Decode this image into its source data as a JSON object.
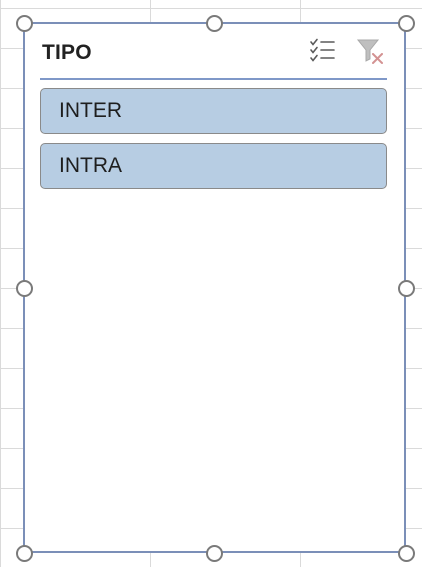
{
  "slicer": {
    "title": "TIPO",
    "items": [
      {
        "label": "INTER",
        "selected": true
      },
      {
        "label": "INTRA",
        "selected": true
      }
    ],
    "icons": {
      "multiselect": "multi-select-icon",
      "clear_filter": "clear-filter-icon"
    },
    "colors": {
      "item_fill": "#b7cde3",
      "border": "#7b8fb8",
      "header_rule": "#7f98c8"
    }
  }
}
